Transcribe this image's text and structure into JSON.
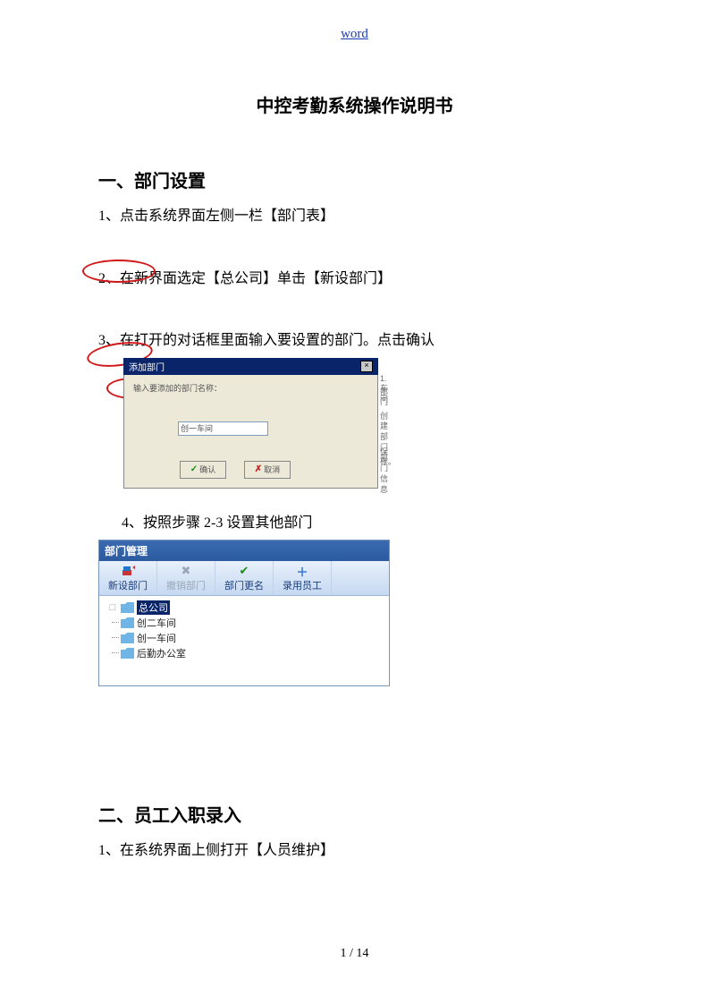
{
  "header_link": "word",
  "title": "中控考勤系统操作说明书",
  "section1": {
    "heading": "一、部门设置",
    "step1": "1、点击系统界面左侧一栏【部门表】",
    "step2": "2、在新界面选定【总公司】单击【新设部门】",
    "step3": "3、在打开的对话框里面输入要设置的部门。点击确认",
    "step4": "4、按照步骤 2-3 设置其他部门"
  },
  "dialog": {
    "title": "添加部门",
    "prompt": "输入要添加的部门名称：",
    "input_value": "创一车间",
    "ok": "确认",
    "cancel": "取消",
    "side1": "1.车间",
    "side2": "部门",
    "side3": "创建部门\n部门信息",
    "side4": "保存。"
  },
  "dept_mgr": {
    "title": "部门管理",
    "toolbar": [
      "新设部门",
      "撤销部门",
      "部门更名",
      "录用员工"
    ],
    "tree": [
      "总公司",
      "创二车间",
      "创一车间",
      "后勤办公室"
    ]
  },
  "section2": {
    "heading": "二、员工入职录入",
    "step1": "1、在系统界面上侧打开【人员维护】"
  },
  "footer": "1 / 14"
}
